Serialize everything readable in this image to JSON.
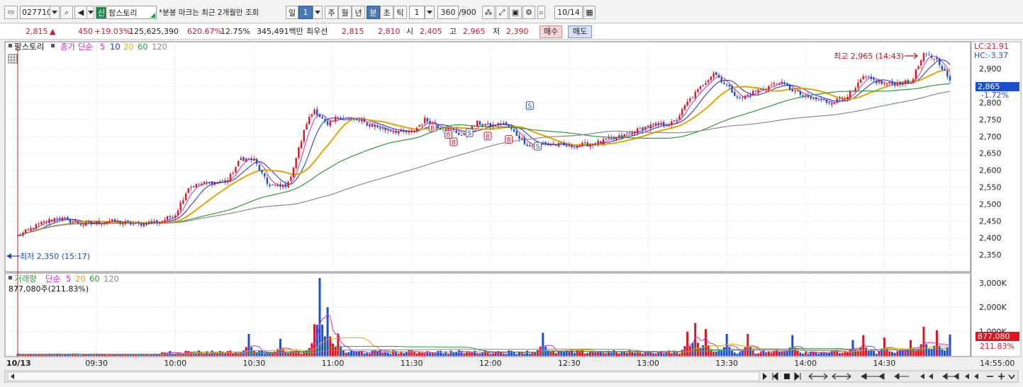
{
  "toolbar": {
    "code": "027710",
    "badge": "신",
    "stock_name": "팜스토리",
    "notice": "*분봉 마크는 최근 2개월만 조회",
    "periods": [
      "일",
      "1",
      "주",
      "월",
      "년",
      "분",
      "초",
      "틱"
    ],
    "selected_period": "분",
    "interval": "1",
    "count": "360",
    "count_max": "/900",
    "date": "10/14"
  },
  "quote": {
    "price": "2,815",
    "change": "450",
    "change_pct": "+19.03%",
    "volume": "125,625,390",
    "vol_ratio": "620.67%",
    "turnover": "12.75%",
    "amount": "345,491백만",
    "best_label": "최우선",
    "ask": "2,815",
    "bid": "2,810",
    "open_label": "시",
    "open": "2,405",
    "high_label": "고",
    "high": "2,965",
    "low_label": "저",
    "low": "2,390",
    "buy": "매수",
    "sell": "매도"
  },
  "legend": {
    "name": "팜스토리",
    "ma_label": "종가 단순",
    "ma": [
      "5",
      "10",
      "20",
      "60",
      "120"
    ],
    "vol_label": "거래량",
    "vol_ma_label": "단순",
    "vol_ma": [
      "5",
      "20",
      "60",
      "120"
    ],
    "vol_value": "877,080주(211.83%)"
  },
  "colors": {
    "up": "#e2141f",
    "down": "#1c4fd0",
    "ma5": "#cc2ac8",
    "ma10": "#1a2bd0",
    "ma20": "#e8a300",
    "ma60": "#2a9a3a",
    "ma120": "#8a8a8a"
  },
  "chart_data": [
    {
      "type": "candlestick",
      "title": "",
      "xlabel": "",
      "ylabel": "",
      "ylim": [
        2300,
        2980
      ],
      "grid": true,
      "y_ticks": [
        "2,900",
        "2,850",
        "2,800",
        "2,750",
        "2,700",
        "2,650",
        "2,600",
        "2,550",
        "2,500",
        "2,450",
        "2,400",
        "2,350"
      ],
      "y_tick_values": [
        2900,
        2850,
        2800,
        2750,
        2700,
        2650,
        2600,
        2550,
        2500,
        2450,
        2400,
        2350
      ],
      "x_ticks": [
        "10/13",
        "09:30",
        "10:00",
        "10:30",
        "11:00",
        "11:30",
        "12:00",
        "12:30",
        "13:00",
        "13:30",
        "14:00",
        "14:30",
        "14:55:00"
      ],
      "x_tick_index": [
        0,
        30,
        60,
        90,
        120,
        150,
        180,
        210,
        240,
        270,
        300,
        330,
        355
      ],
      "close_path": {
        "minutes": [
          0,
          8,
          15,
          25,
          35,
          45,
          55,
          60,
          65,
          70,
          80,
          85,
          90,
          95,
          100,
          103,
          110,
          113,
          118,
          122,
          130,
          140,
          150,
          155,
          160,
          165,
          170,
          175,
          180,
          185,
          195,
          200,
          210,
          220,
          230,
          240,
          250,
          255,
          265,
          270,
          275,
          280,
          290,
          300,
          310,
          318,
          322,
          330,
          340,
          345,
          350,
          355
        ],
        "close": [
          2405,
          2440,
          2460,
          2440,
          2450,
          2440,
          2450,
          2470,
          2550,
          2560,
          2570,
          2635,
          2630,
          2560,
          2550,
          2560,
          2740,
          2780,
          2730,
          2760,
          2745,
          2720,
          2710,
          2750,
          2730,
          2720,
          2700,
          2740,
          2730,
          2740,
          2670,
          2680,
          2670,
          2680,
          2700,
          2730,
          2740,
          2800,
          2890,
          2850,
          2810,
          2830,
          2860,
          2815,
          2800,
          2830,
          2875,
          2855,
          2860,
          2940,
          2930,
          2865
        ]
      },
      "ma_periods": [
        5,
        10,
        20,
        60,
        120
      ],
      "annotations": [
        "최고 2,965 (14:43)",
        "최저 2,350 (15:17)"
      ],
      "marks": [
        {
          "label": "B",
          "minute": 158,
          "price": 2725
        },
        {
          "label": "B",
          "minute": 164,
          "price": 2705
        },
        {
          "label": "B",
          "minute": 166,
          "price": 2683
        },
        {
          "label": "S",
          "minute": 172,
          "price": 2710
        },
        {
          "label": "B",
          "minute": 179,
          "price": 2700
        },
        {
          "label": "B",
          "minute": 187,
          "price": 2690
        },
        {
          "label": "S",
          "minute": 195,
          "price": 2790
        },
        {
          "label": "S",
          "minute": 198,
          "price": 2670
        }
      ],
      "right_labels": [
        "LC:21.91",
        "HC:-3.37",
        "2,865",
        "-1.72%"
      ]
    },
    {
      "type": "bar",
      "title": "",
      "ylim": [
        0,
        3400
      ],
      "y_ticks": [
        "3,000K",
        "2,000K",
        "1,000K"
      ],
      "y_tick_values": [
        3000,
        2000,
        1000
      ],
      "volume_spikes": {
        "minutes": [
          88,
          100,
          113,
          115,
          118,
          122,
          200,
          255,
          258,
          262,
          270,
          278,
          295,
          318,
          322,
          330,
          340,
          345,
          350,
          355
        ],
        "value_k": [
          900,
          700,
          1300,
          3200,
          2000,
          900,
          950,
          1000,
          1350,
          1100,
          900,
          900,
          850,
          650,
          850,
          750,
          650,
          1200,
          1050,
          877
        ]
      },
      "right_labels": [
        "877,080",
        "211.83%"
      ]
    }
  ]
}
